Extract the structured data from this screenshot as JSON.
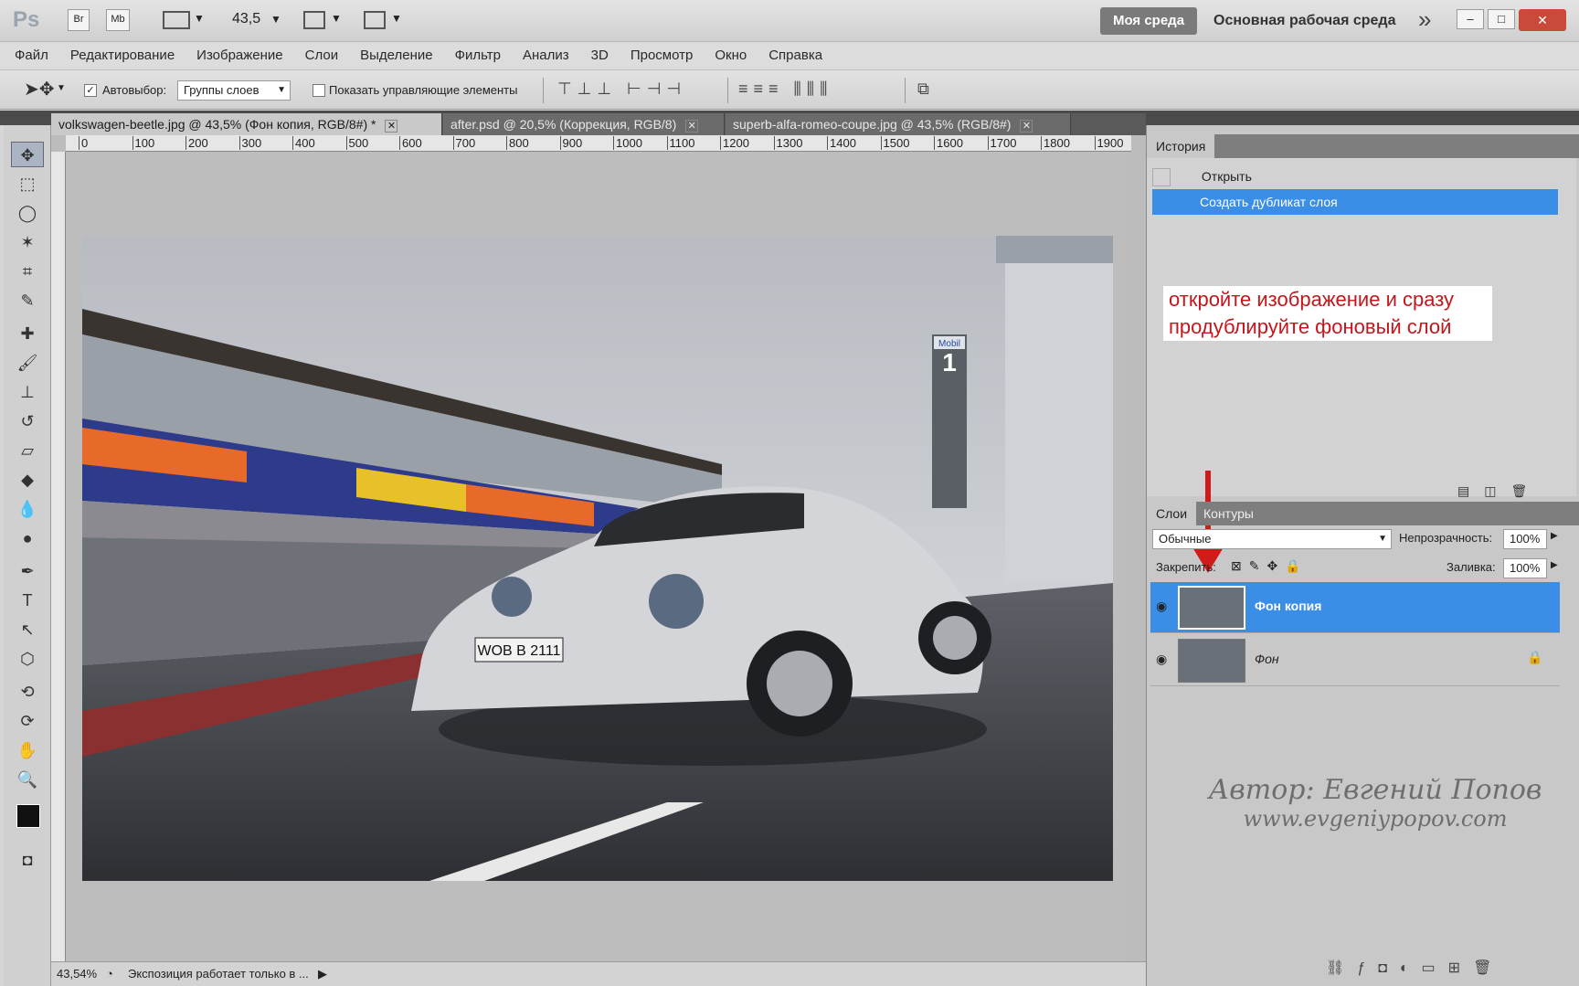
{
  "app": {
    "logo": "Ps",
    "br": "Br",
    "mb": "Mb",
    "zoom": "43,5",
    "workspace_btn": "Моя среда",
    "workspace_label": "Основная рабочая среда",
    "expand": "»"
  },
  "window_controls": {
    "minimize": "–",
    "maximize": "□",
    "close": "✕"
  },
  "menu": [
    "Файл",
    "Редактирование",
    "Изображение",
    "Слои",
    "Выделение",
    "Фильтр",
    "Анализ",
    "3D",
    "Просмотр",
    "Окно",
    "Справка"
  ],
  "options": {
    "autoselect_label": "Автовыбор:",
    "autoselect_value": "Группы слоев",
    "show_controls": "Показать управляющие элементы"
  },
  "tabs": [
    {
      "label": "volkswagen-beetle.jpg @ 43,5% (Фон копия, RGB/8#) *",
      "active": true
    },
    {
      "label": "after.psd @ 20,5% (Коррекция, RGB/8)",
      "active": false
    },
    {
      "label": "superb-alfa-romeo-coupe.jpg @ 43,5% (RGB/8#)",
      "active": false
    }
  ],
  "ruler": {
    "ticks": [
      "0",
      "100",
      "200",
      "300",
      "400",
      "500",
      "600",
      "700",
      "800",
      "900",
      "1000",
      "1100",
      "1200",
      "1300",
      "1400",
      "1500",
      "1600",
      "1700",
      "1800",
      "1900"
    ]
  },
  "status": {
    "zoom": "43,54%",
    "message": "Экспозиция работает только в ..."
  },
  "photo": {
    "plate": "WOB B 2111",
    "sign_brand": "Mobil",
    "sign_num": "1"
  },
  "history": {
    "tab": "История",
    "items": [
      {
        "label": "Открыть",
        "selected": false
      },
      {
        "label": "Создать дубликат слоя",
        "selected": true
      }
    ]
  },
  "annotation": {
    "line1": "откройте изображение и сразу",
    "line2": "продублируйте фоновый слой"
  },
  "layers": {
    "tab": "Слои",
    "tab2": "Контуры",
    "blend": "Обычные",
    "opacity_label": "Непрозрачность:",
    "opacity": "100%",
    "lock_label": "Закрепить:",
    "fill_label": "Заливка:",
    "fill": "100%",
    "items": [
      {
        "name": "Фон копия",
        "selected": true
      },
      {
        "name": "Фон",
        "selected": false
      }
    ]
  },
  "watermark": {
    "line1": "Автор: Евгений Попов",
    "line2": "www.evgeniypopov.com"
  },
  "colors": {
    "selection": "#3a8ee6",
    "annotation": "#c4161c",
    "arrow": "#d11a1a"
  }
}
